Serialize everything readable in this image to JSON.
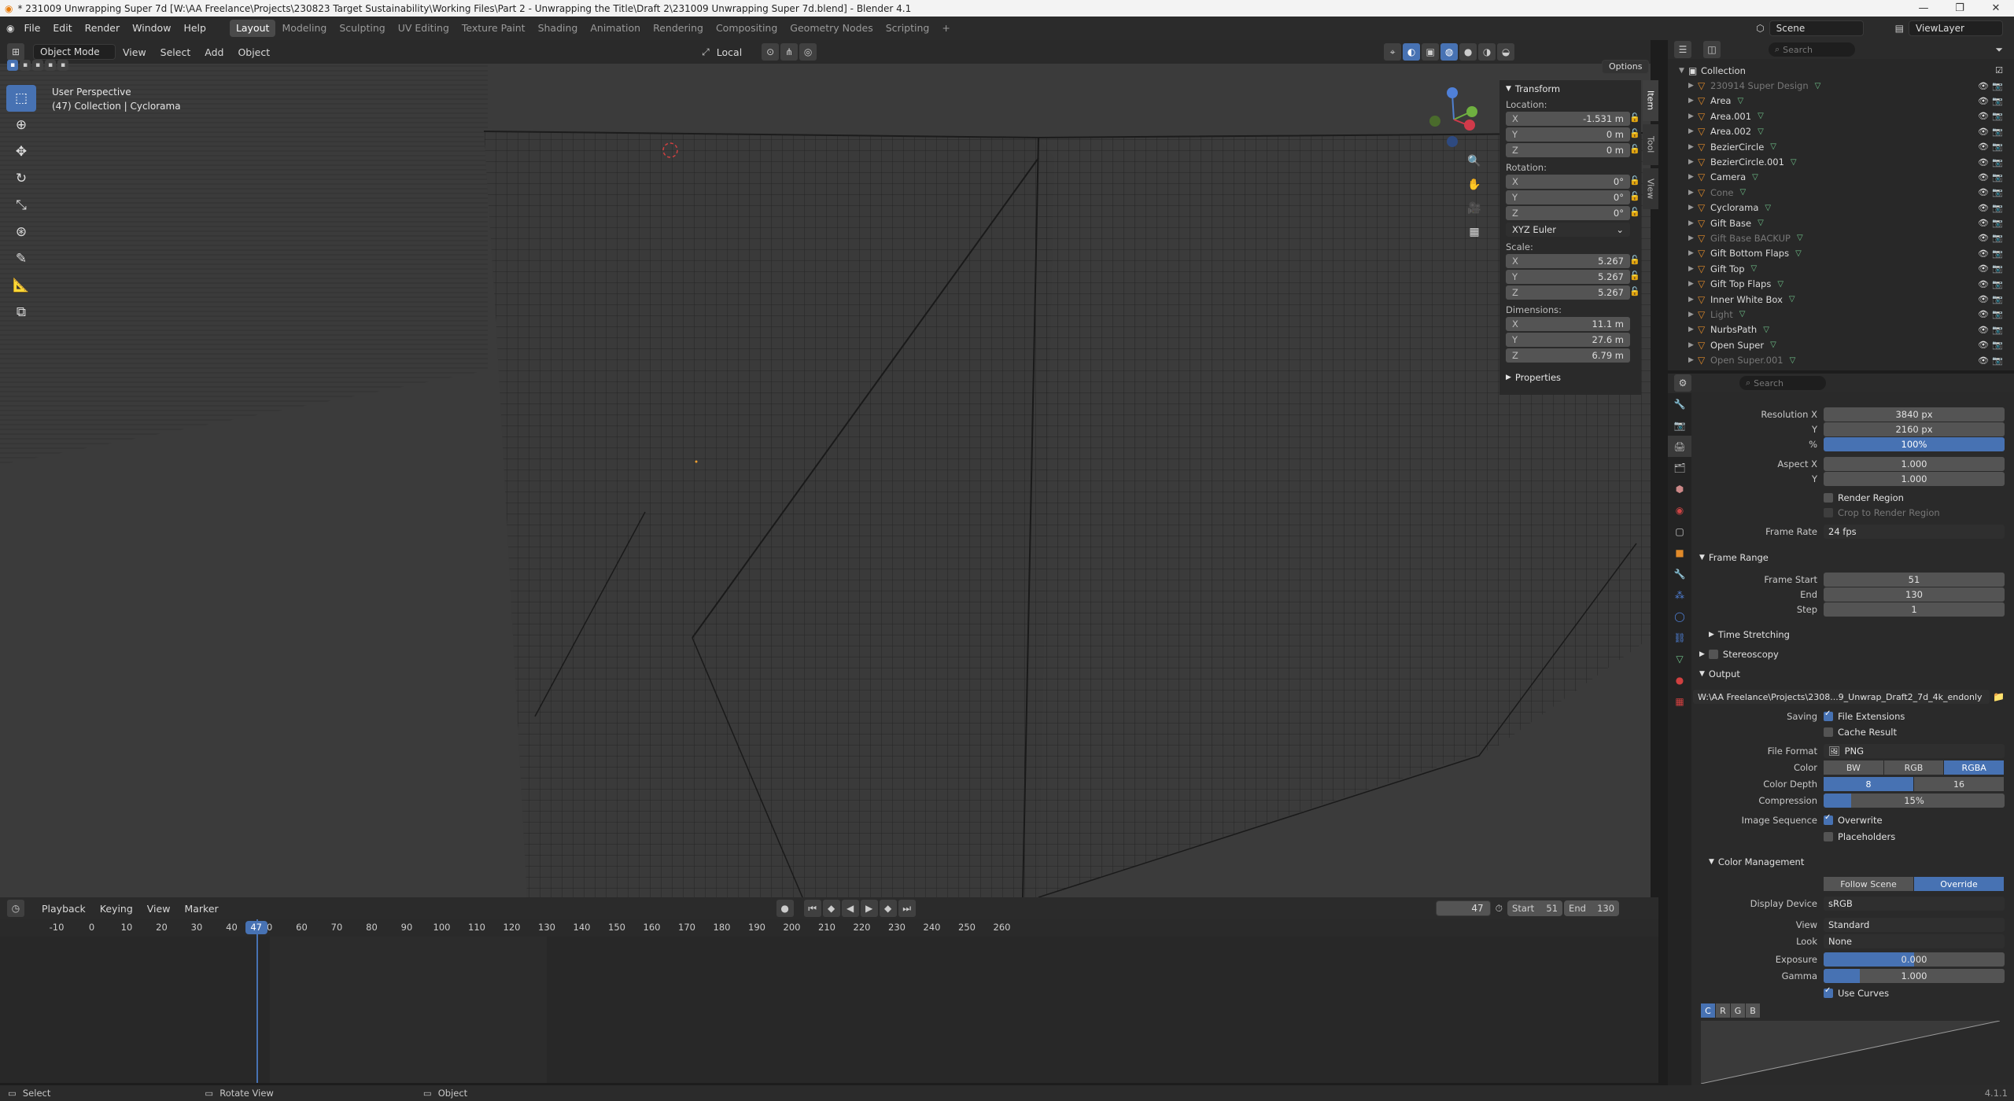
{
  "window": {
    "title": "* 231009 Unwrapping Super 7d [W:\\AA Freelance\\Projects\\230823 Target Sustainability\\Working Files\\Part 2 - Unwrapping the Title\\Draft 2\\231009 Unwrapping Super 7d.blend] - Blender 4.1",
    "min": "—",
    "max": "❐",
    "close": "✕"
  },
  "menu": [
    "File",
    "Edit",
    "Render",
    "Window",
    "Help"
  ],
  "workspaces": [
    "Layout",
    "Modeling",
    "Sculpting",
    "UV Editing",
    "Texture Paint",
    "Shading",
    "Animation",
    "Rendering",
    "Compositing",
    "Geometry Nodes",
    "Scripting",
    "+"
  ],
  "scene": {
    "name": "Scene",
    "view_layer": "ViewLayer"
  },
  "viewport_header": {
    "mode": "Object Mode",
    "menus": [
      "View",
      "Select",
      "Add",
      "Object"
    ],
    "orientation": "Local",
    "options": "Options"
  },
  "overlay": {
    "line1": "User Perspective",
    "line2": "(47) Collection | Cyclorama"
  },
  "npanel": {
    "tabs": [
      "Item",
      "Tool",
      "View"
    ],
    "transform": "Transform",
    "location_label": "Location:",
    "location": [
      {
        "axis": "X",
        "value": "-1.531 m"
      },
      {
        "axis": "Y",
        "value": "0 m"
      },
      {
        "axis": "Z",
        "value": "0 m"
      }
    ],
    "rotation_label": "Rotation:",
    "rotation": [
      {
        "axis": "X",
        "value": "0°"
      },
      {
        "axis": "Y",
        "value": "0°"
      },
      {
        "axis": "Z",
        "value": "0°"
      }
    ],
    "rotation_mode": "XYZ Euler",
    "scale_label": "Scale:",
    "scale": [
      {
        "axis": "X",
        "value": "5.267"
      },
      {
        "axis": "Y",
        "value": "5.267"
      },
      {
        "axis": "Z",
        "value": "5.267"
      }
    ],
    "dimensions_label": "Dimensions:",
    "dimensions": [
      {
        "axis": "X",
        "value": "11.1 m"
      },
      {
        "axis": "Y",
        "value": "27.6 m"
      },
      {
        "axis": "Z",
        "value": "6.79 m"
      }
    ],
    "properties": "Properties"
  },
  "timeline": {
    "menus": [
      "Playback",
      "Keying",
      "View",
      "Marker"
    ],
    "current_frame": "47",
    "start_label": "Start",
    "start": "51",
    "end_label": "End",
    "end": "130",
    "ticks": [
      "-10",
      "0",
      "10",
      "20",
      "30",
      "40",
      "50",
      "60",
      "70",
      "80",
      "90",
      "100",
      "110",
      "120",
      "130",
      "140",
      "150",
      "160",
      "170",
      "180",
      "190",
      "200",
      "210",
      "220",
      "230",
      "240",
      "250",
      "260"
    ]
  },
  "statusbar": {
    "select": "Select",
    "rotate": "Rotate View",
    "object": "Object",
    "version": "4.1.1"
  },
  "outliner": {
    "search_placeholder": "Search",
    "collection": "Collection",
    "items": [
      {
        "name": "230914 Super Design",
        "dim": true
      },
      {
        "name": "Area",
        "dim": false
      },
      {
        "name": "Area.001",
        "dim": false
      },
      {
        "name": "Area.002",
        "dim": false
      },
      {
        "name": "BezierCircle",
        "dim": false
      },
      {
        "name": "BezierCircle.001",
        "dim": false
      },
      {
        "name": "Camera",
        "dim": false
      },
      {
        "name": "Cone",
        "dim": true
      },
      {
        "name": "Cyclorama",
        "dim": false
      },
      {
        "name": "Gift Base",
        "dim": false
      },
      {
        "name": "Gift Base BACKUP",
        "dim": true
      },
      {
        "name": "Gift Bottom Flaps",
        "dim": false
      },
      {
        "name": "Gift Top",
        "dim": false
      },
      {
        "name": "Gift Top Flaps",
        "dim": false
      },
      {
        "name": "Inner White Box",
        "dim": false
      },
      {
        "name": "Light",
        "dim": true
      },
      {
        "name": "NurbsPath",
        "dim": false
      },
      {
        "name": "Open Super",
        "dim": false
      },
      {
        "name": "Open Super.001",
        "dim": true
      }
    ]
  },
  "properties": {
    "search_placeholder": "Search",
    "resolution_x_label": "Resolution X",
    "resolution_x": "3840 px",
    "resolution_y_label": "Y",
    "resolution_y": "2160 px",
    "percent_label": "%",
    "percent": "100%",
    "aspect_x_label": "Aspect X",
    "aspect_x": "1.000",
    "aspect_y_label": "Y",
    "aspect_y": "1.000",
    "render_region": "Render Region",
    "crop_region": "Crop to Render Region",
    "frame_rate_label": "Frame Rate",
    "frame_rate": "24 fps",
    "frame_range": "Frame Range",
    "frame_start_label": "Frame Start",
    "frame_start": "51",
    "end_label": "End",
    "end": "130",
    "step_label": "Step",
    "step": "1",
    "time_stretching": "Time Stretching",
    "stereoscopy": "Stereoscopy",
    "output": "Output",
    "output_path": "W:\\AA Freelance\\Projects\\2308...9_Unwrap_Draft2_7d_4k_endonly",
    "saving_label": "Saving",
    "file_extensions": "File Extensions",
    "cache_result": "Cache Result",
    "file_format_label": "File Format",
    "file_format": "PNG",
    "color_label": "Color",
    "color_options": [
      "BW",
      "RGB",
      "RGBA"
    ],
    "color_depth_label": "Color Depth",
    "depth_options": [
      "8",
      "16"
    ],
    "compression_label": "Compression",
    "compression": "15%",
    "compression_value": 0.15,
    "image_sequence_label": "Image Sequence",
    "overwrite": "Overwrite",
    "placeholders": "Placeholders",
    "color_management": "Color Management",
    "cm_options": [
      "Follow Scene",
      "Override"
    ],
    "display_device_label": "Display Device",
    "display_device": "sRGB",
    "view_label": "View",
    "view": "Standard",
    "look_label": "Look",
    "look": "None",
    "exposure_label": "Exposure",
    "exposure": "0.000",
    "gamma_label": "Gamma",
    "gamma": "1.000",
    "use_curves": "Use Curves",
    "curve_channels": [
      "C",
      "R",
      "G",
      "B"
    ]
  }
}
